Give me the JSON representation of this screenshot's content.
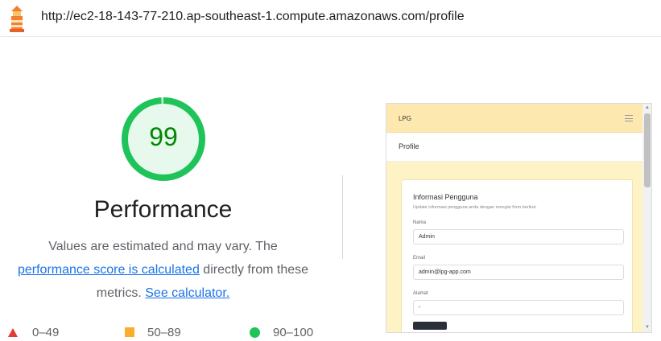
{
  "url": "http://ec2-18-143-77-210.ap-southeast-1.compute.amazonaws.com/profile",
  "score": {
    "value": "99",
    "fraction": 0.99,
    "color": "#0c9a3a",
    "bg": "#e7f8ec"
  },
  "category": {
    "title": "Performance",
    "desc_line1": "Values are estimated and may vary. The",
    "desc_link": "performance score is calculated",
    "desc_after_link": " directly from these",
    "desc_line3_prefix": "metrics. ",
    "calc_link": "See calculator."
  },
  "legend": {
    "fail": "0–49",
    "average": "50–89",
    "pass": "90–100"
  },
  "thumbnail": {
    "brand": "LPG",
    "page_title": "Profile",
    "card_title": "Informasi Pengguna",
    "card_subtitle": "Update informasi pengguna anda dengan mengisi form berikut.",
    "fields": [
      {
        "label": "Nama",
        "value": "Admin"
      },
      {
        "label": "Email",
        "value": "admin@lpg-app.com"
      },
      {
        "label": "Alamat",
        "value": "-"
      }
    ]
  },
  "icons": {
    "logo": "lighthouse-icon",
    "menu": "hamburger-icon"
  }
}
